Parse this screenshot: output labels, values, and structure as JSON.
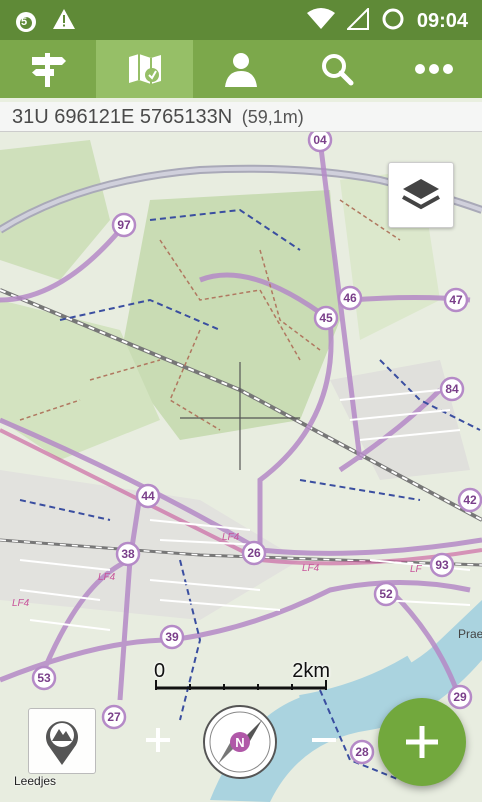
{
  "status_bar": {
    "time": "09:04",
    "notification_badge": "5",
    "icons": [
      "notification-icon",
      "warning-icon",
      "wifi-icon",
      "signal-icon",
      "battery-icon"
    ]
  },
  "toolbar": {
    "tabs": [
      {
        "name": "signpost-icon",
        "active": false
      },
      {
        "name": "map-icon",
        "active": true
      },
      {
        "name": "person-icon",
        "active": false
      },
      {
        "name": "search-icon",
        "active": false
      },
      {
        "name": "more-icon",
        "active": false
      }
    ]
  },
  "coordinates": {
    "utm": "31U 696121E 5765133N",
    "elevation": "(59,1m)"
  },
  "map": {
    "route_labels": [
      "04",
      "97",
      "46",
      "47",
      "45",
      "84",
      "44",
      "42",
      "38",
      "26",
      "93",
      "52",
      "39",
      "53",
      "27",
      "28",
      "29"
    ],
    "trail_labels": [
      "LF4",
      "LF4",
      "LF4",
      "LF4",
      "LF"
    ],
    "place_label": "Prae"
  },
  "scale": {
    "start_label": "0",
    "end_label": "2km"
  },
  "controls": {
    "pin_label": "Leedjes",
    "compass_letter": "N",
    "zoom_in": "+",
    "zoom_out": "−",
    "add": "+"
  },
  "colors": {
    "statusbar": "#5f8a37",
    "toolbar": "#7ca84b",
    "active_tab": "#96bf67",
    "fab": "#72a83d",
    "route_purple": "#b58ac7"
  }
}
